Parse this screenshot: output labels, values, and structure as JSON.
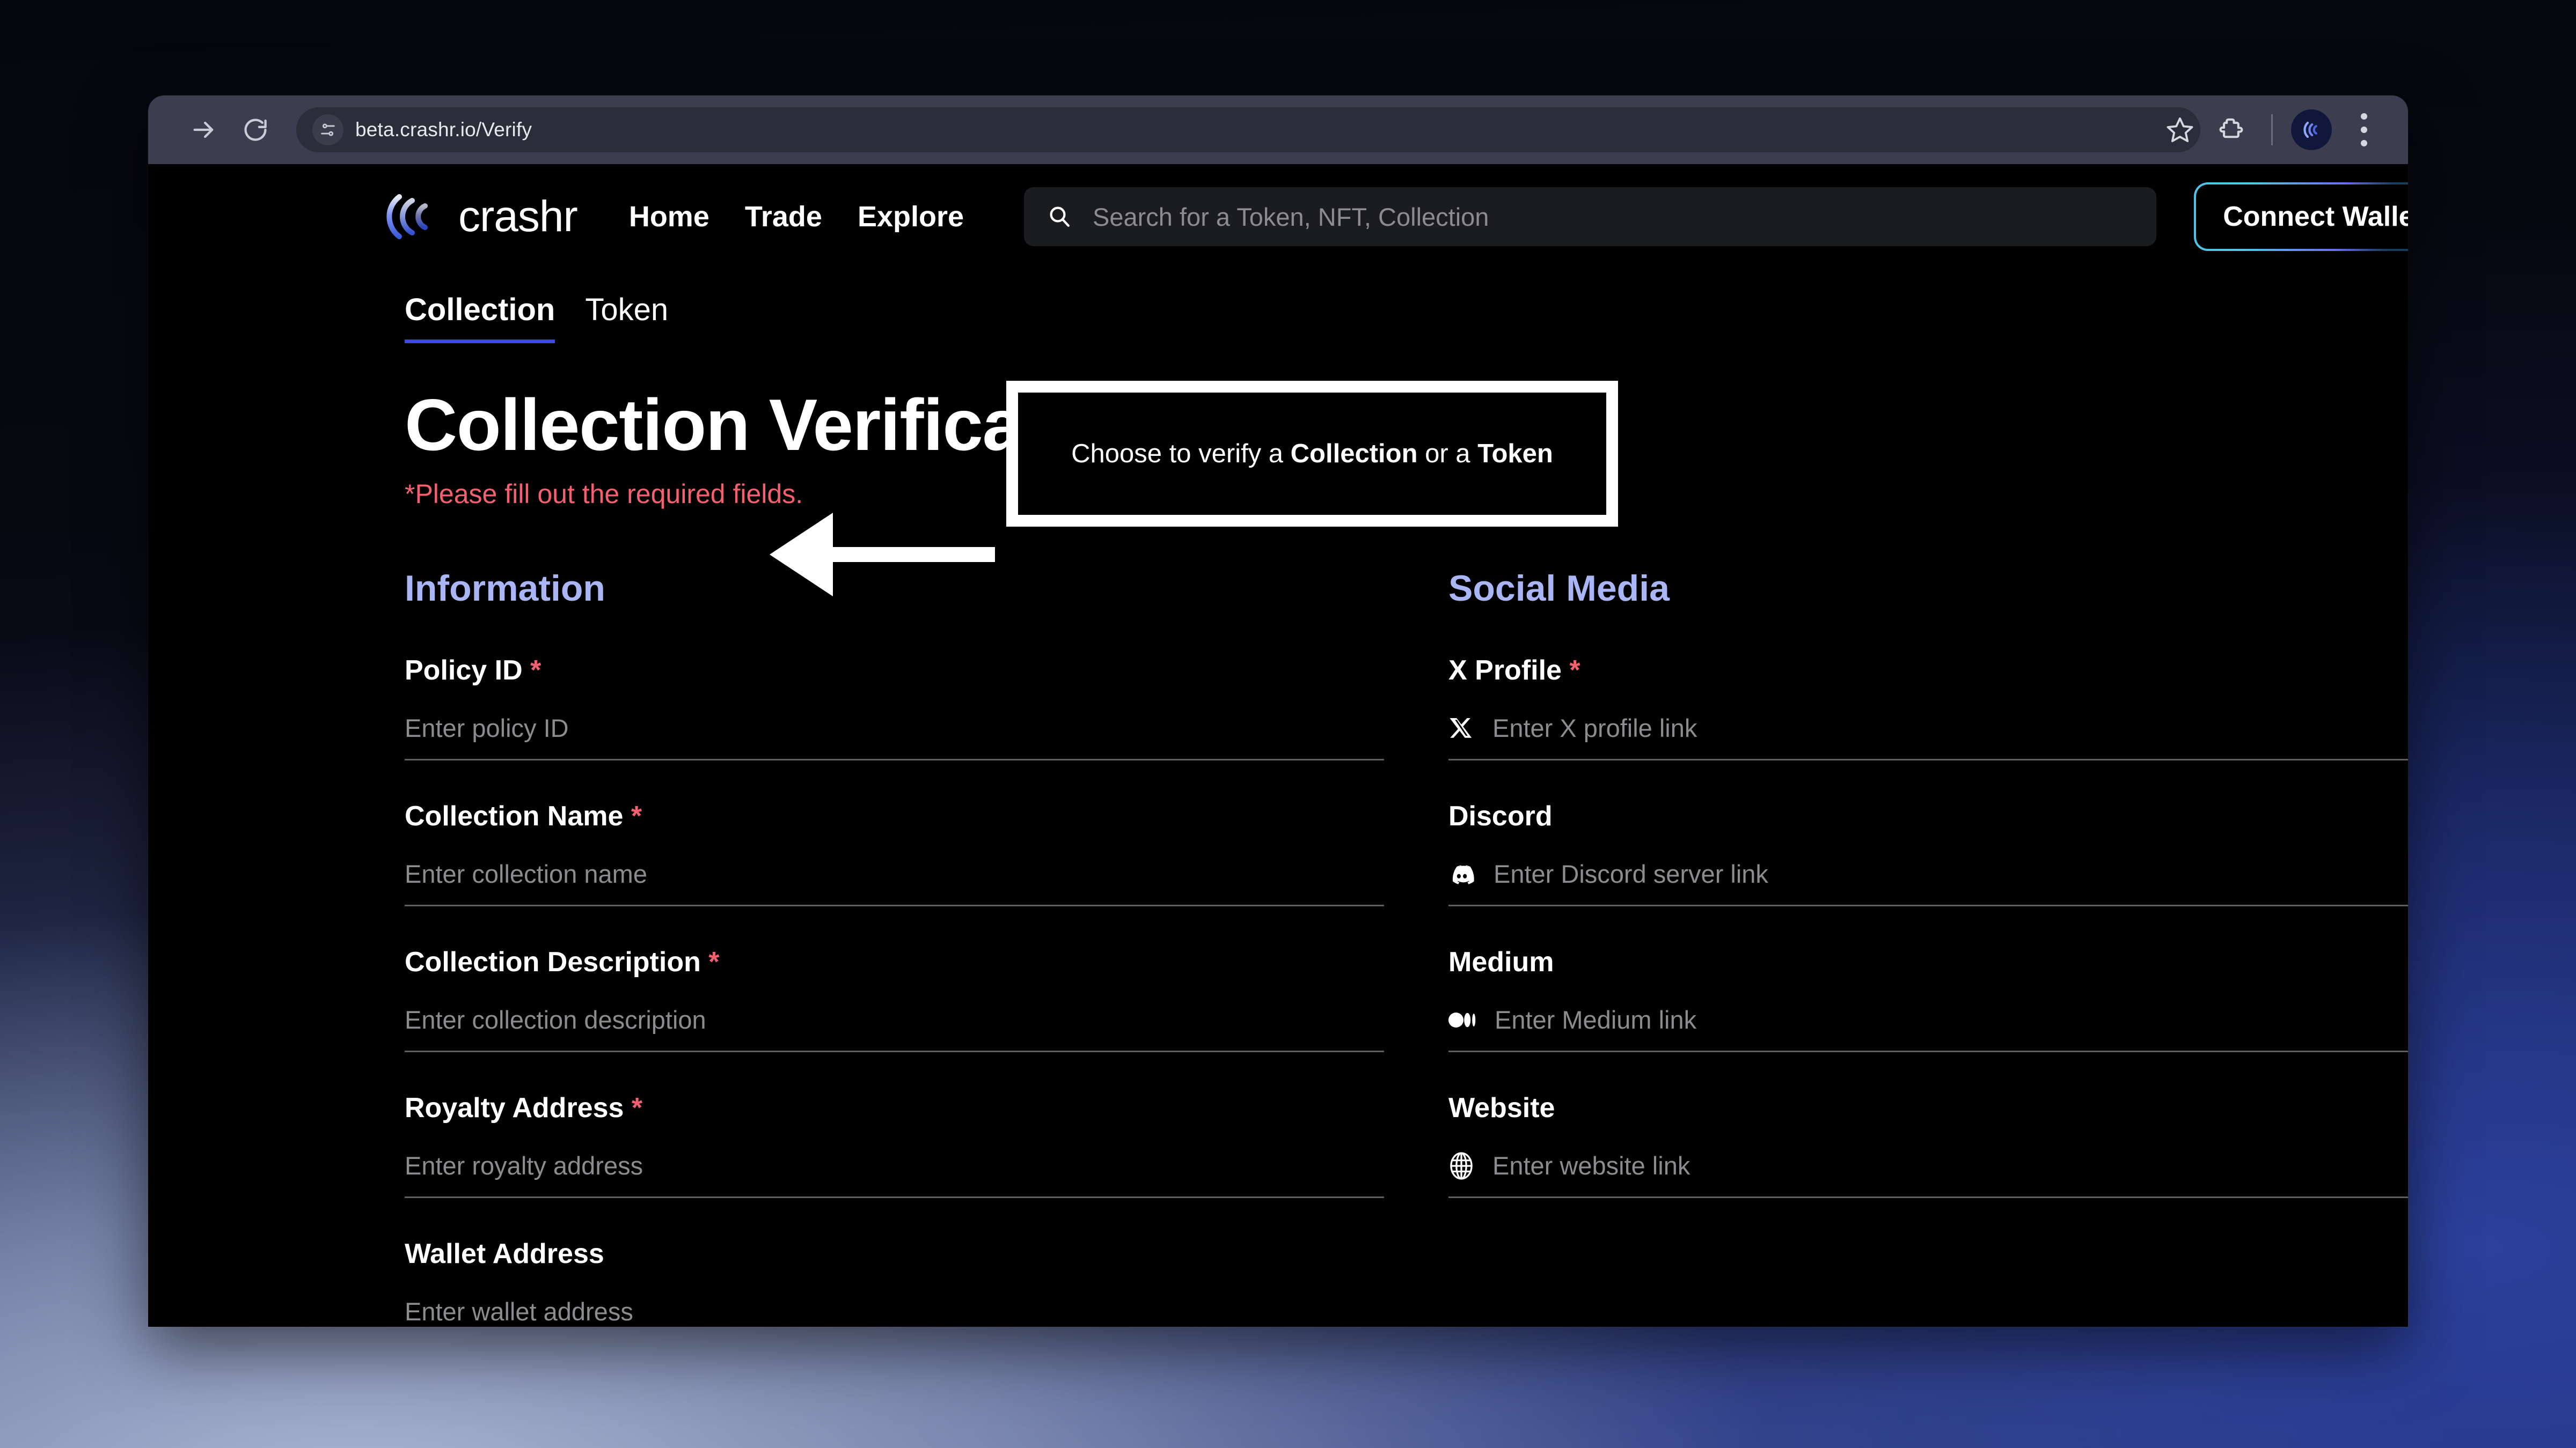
{
  "browser": {
    "url": "beta.crashr.io/Verify",
    "forward_tooltip": "Forward",
    "reload_tooltip": "Reload",
    "site_info_tooltip": "View site information",
    "bookmark_tooltip": "Bookmark this tab",
    "extensions_tooltip": "Extensions",
    "profile_tooltip": "Profile",
    "menu_tooltip": "Customize and control Chrome"
  },
  "header": {
    "brand": "crashr",
    "nav": [
      {
        "label": "Home"
      },
      {
        "label": "Trade"
      },
      {
        "label": "Explore"
      }
    ],
    "search": {
      "placeholder": "Search for a Token, NFT, Collection"
    },
    "connect_wallet": "Connect Wallet"
  },
  "tabs": [
    {
      "label": "Collection",
      "active": true
    },
    {
      "label": "Token",
      "active": false
    }
  ],
  "annotation": {
    "prefix": "Choose to verify a ",
    "bold1": "Collection",
    "middle": " or a ",
    "bold2": "Token"
  },
  "page": {
    "title": "Collection Verification Application",
    "required_note": "*Please fill out the required fields."
  },
  "information": {
    "section_title": "Information",
    "fields": [
      {
        "label": "Policy ID",
        "required": true,
        "placeholder": "Enter policy ID",
        "icon": null
      },
      {
        "label": "Collection Name",
        "required": true,
        "placeholder": "Enter collection name",
        "icon": null
      },
      {
        "label": "Collection Description",
        "required": true,
        "placeholder": "Enter collection description",
        "icon": null
      },
      {
        "label": "Royalty Address",
        "required": true,
        "placeholder": "Enter royalty address",
        "icon": null
      },
      {
        "label": "Wallet Address",
        "required": false,
        "placeholder": "Enter wallet address",
        "icon": null
      }
    ]
  },
  "social_media": {
    "section_title": "Social Media",
    "fields": [
      {
        "label": "X Profile",
        "required": true,
        "placeholder": "Enter X profile link",
        "icon": "x-logo-icon"
      },
      {
        "label": "Discord",
        "required": false,
        "placeholder": "Enter Discord server link",
        "icon": "discord-logo-icon"
      },
      {
        "label": "Medium",
        "required": false,
        "placeholder": "Enter Medium link",
        "icon": "medium-logo-icon"
      },
      {
        "label": "Website",
        "required": false,
        "placeholder": "Enter website link",
        "icon": "globe-icon"
      }
    ]
  },
  "colors": {
    "accent_blue": "#3b49df",
    "section_heading": "#a9b5f5",
    "required_red": "#f4606e",
    "page_background": "#000000",
    "toolbar": "#3c3e50"
  }
}
